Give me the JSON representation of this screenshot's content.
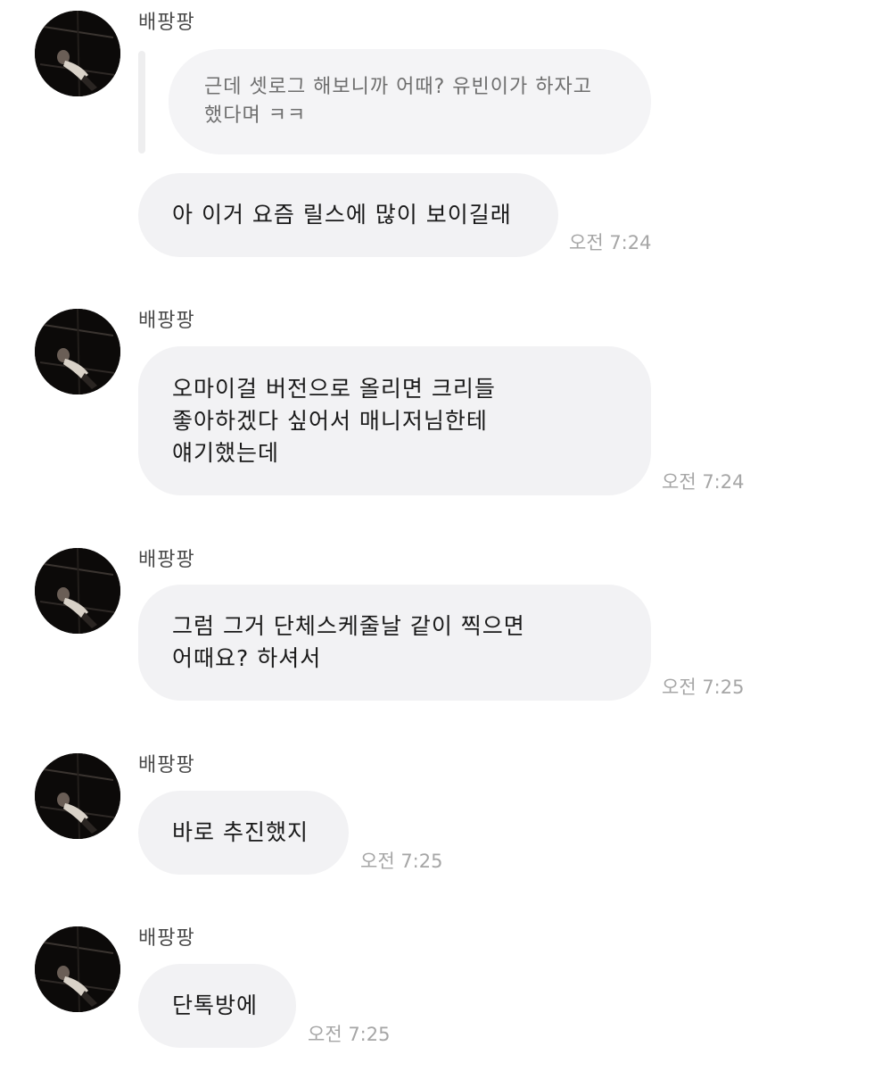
{
  "sender_name": "배팡팡",
  "reply": {
    "lines": [
      "근데 셋로그 해보니까 어때? 유빈이가 하자고",
      "했다며 ㅋㅋ"
    ]
  },
  "messages": [
    {
      "lines": [
        "아 이거 요즘 릴스에 많이 보이길래"
      ],
      "time": "오전 7:24"
    },
    {
      "lines": [
        "오마이걸 버전으로 올리면 크리들",
        "좋아하겠다 싶어서 매니저님한테",
        "얘기했는데"
      ],
      "time": "오전 7:24"
    },
    {
      "lines": [
        "그럼 그거 단체스케줄날 같이 찍으면",
        "어때요? 하셔서"
      ],
      "time": "오전 7:25"
    },
    {
      "lines": [
        "바로 추진했지"
      ],
      "time": "오전 7:25"
    },
    {
      "lines": [
        "단톡방에"
      ],
      "time": "오전 7:25"
    }
  ],
  "colors": {
    "bubble": "#f2f2f4",
    "time": "#a6a6a6",
    "text": "#1a1a1a"
  }
}
